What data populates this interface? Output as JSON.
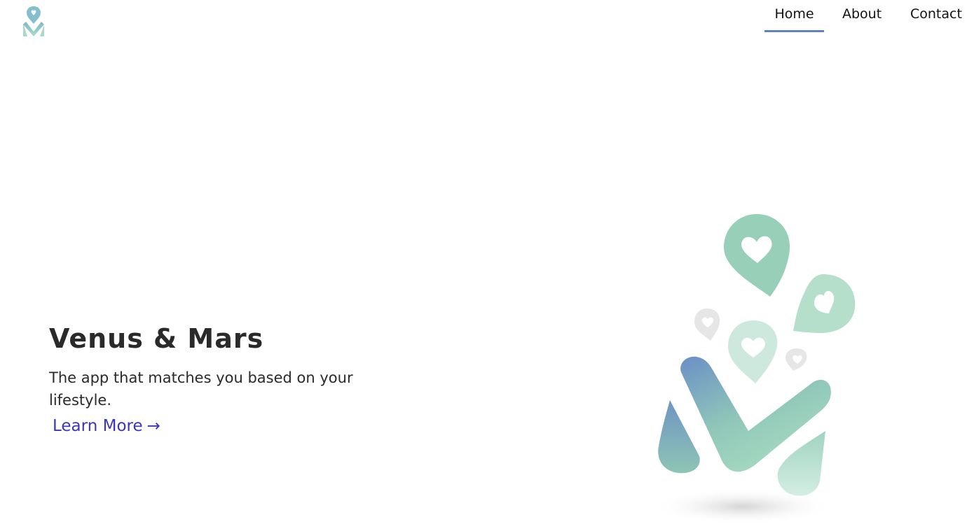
{
  "header": {
    "logo_icon": "location-pin-check-logo-icon",
    "nav": [
      {
        "label": "Home",
        "active": true
      },
      {
        "label": "About",
        "active": false
      },
      {
        "label": "Contact",
        "active": false
      }
    ],
    "active_color": "#5f82c4"
  },
  "hero": {
    "title": "Venus & Mars",
    "subtitle": "The app that matches you based on your lifestyle.",
    "cta_label": "Learn More",
    "cta_arrow": "→",
    "cta_color": "#3c36bd"
  },
  "illustration": {
    "icon": "heart-pins-check-illustration-icon",
    "colors": {
      "blue": "#6a8fc6",
      "green": "#94cdb4",
      "light_green": "#cde8dd",
      "grey": "#e5e5e5"
    }
  }
}
